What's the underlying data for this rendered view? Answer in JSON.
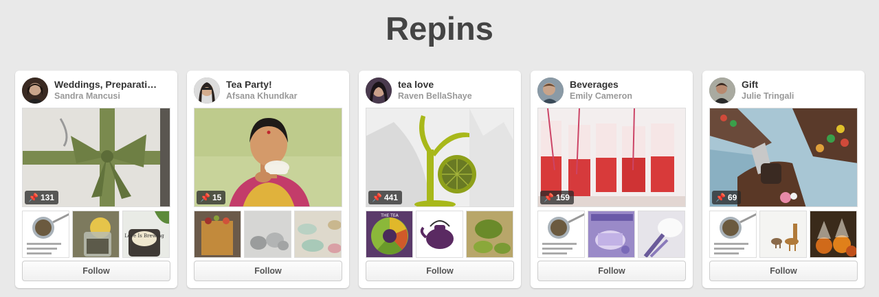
{
  "page": {
    "title": "Repins"
  },
  "boards": [
    {
      "name": "Weddings, Preparati…",
      "owner": "Sandra Mancusi",
      "pin_count": "131",
      "follow_label": "Follow"
    },
    {
      "name": "Tea Party!",
      "owner": "Afsana Khundkar",
      "pin_count": "15",
      "follow_label": "Follow"
    },
    {
      "name": "tea love",
      "owner": "Raven BellaShaye",
      "pin_count": "441",
      "follow_label": "Follow"
    },
    {
      "name": "Beverages",
      "owner": "Emily Cameron",
      "pin_count": "159",
      "follow_label": "Follow"
    },
    {
      "name": "Gift",
      "owner": "Julie Tringali",
      "pin_count": "69",
      "follow_label": "Follow"
    }
  ],
  "thumb_texts": {
    "tea_label": "Love Is Brewing",
    "tea_wheel": "THE TEA"
  },
  "icons": {
    "pin": "pin-icon"
  }
}
